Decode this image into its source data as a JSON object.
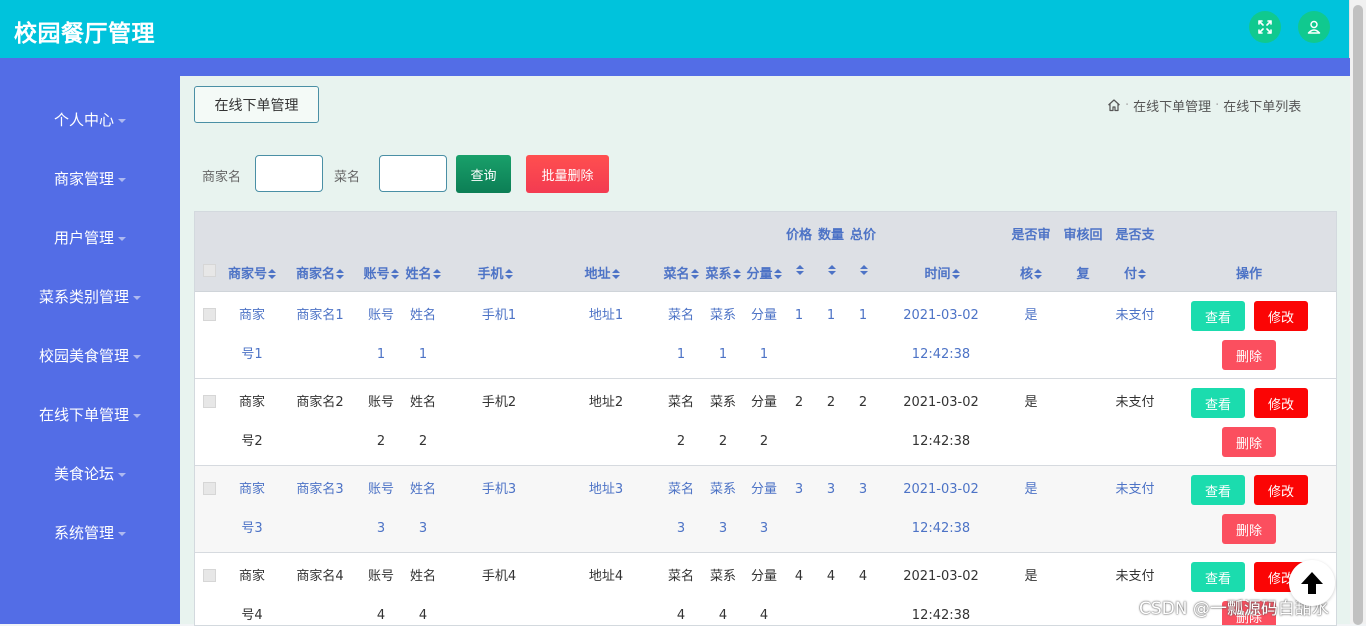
{
  "app": {
    "title": "校园餐厅管理"
  },
  "sidebar": {
    "items": [
      {
        "label": "个人中心"
      },
      {
        "label": "商家管理"
      },
      {
        "label": "用户管理"
      },
      {
        "label": "菜系类别管理"
      },
      {
        "label": "校园美食管理"
      },
      {
        "label": "在线下单管理"
      },
      {
        "label": "美食论坛"
      },
      {
        "label": "系统管理"
      }
    ]
  },
  "page": {
    "tag_label": "在线下单管理",
    "breadcrumb": [
      "在线下单管理",
      "在线下单列表"
    ]
  },
  "search": {
    "merchant_label": "商家名",
    "merchant_value": "",
    "dish_label": "菜名",
    "dish_value": "",
    "query_label": "查询",
    "batch_delete_label": "批量删除"
  },
  "table": {
    "headers": {
      "merchant_no": "商家号",
      "merchant_name": "商家名",
      "account": "账号",
      "name": "姓名",
      "phone": "手机",
      "address": "地址",
      "dish": "菜名",
      "cuisine": "菜系",
      "portion": "分量",
      "price": "价格",
      "quantity": "数量",
      "total": "总价",
      "time": "时间",
      "reviewed_1": "是否审",
      "reviewed_2": "核",
      "reply_1": "审核回",
      "reply_2": "复",
      "paid_1": "是否支",
      "paid_2": "付",
      "actions": "操作"
    },
    "rows": [
      {
        "mno1": "商家",
        "mno2": "号1",
        "mname": "商家名1",
        "acc1": "账号",
        "acc2": "1",
        "nm1": "姓名",
        "nm2": "1",
        "phone": "手机1",
        "addr": "地址1",
        "dish1": "菜名",
        "dish2": "1",
        "cui1": "菜系",
        "cui2": "1",
        "por1": "分量",
        "por2": "1",
        "price": "1",
        "qty": "1",
        "total": "1",
        "time1": "2021-03-02",
        "time2": "12:42:38",
        "reviewed": "是",
        "reply": "",
        "paid": "未支付"
      },
      {
        "mno1": "商家",
        "mno2": "号2",
        "mname": "商家名2",
        "acc1": "账号",
        "acc2": "2",
        "nm1": "姓名",
        "nm2": "2",
        "phone": "手机2",
        "addr": "地址2",
        "dish1": "菜名",
        "dish2": "2",
        "cui1": "菜系",
        "cui2": "2",
        "por1": "分量",
        "por2": "2",
        "price": "2",
        "qty": "2",
        "total": "2",
        "time1": "2021-03-02",
        "time2": "12:42:38",
        "reviewed": "是",
        "reply": "",
        "paid": "未支付"
      },
      {
        "mno1": "商家",
        "mno2": "号3",
        "mname": "商家名3",
        "acc1": "账号",
        "acc2": "3",
        "nm1": "姓名",
        "nm2": "3",
        "phone": "手机3",
        "addr": "地址3",
        "dish1": "菜名",
        "dish2": "3",
        "cui1": "菜系",
        "cui2": "3",
        "por1": "分量",
        "por2": "3",
        "price": "3",
        "qty": "3",
        "total": "3",
        "time1": "2021-03-02",
        "time2": "12:42:38",
        "reviewed": "是",
        "reply": "",
        "paid": "未支付"
      },
      {
        "mno1": "商家",
        "mno2": "号4",
        "mname": "商家名4",
        "acc1": "账号",
        "acc2": "4",
        "nm1": "姓名",
        "nm2": "4",
        "phone": "手机4",
        "addr": "地址4",
        "dish1": "菜名",
        "dish2": "4",
        "cui1": "菜系",
        "cui2": "4",
        "por1": "分量",
        "por2": "4",
        "price": "4",
        "qty": "4",
        "total": "4",
        "time1": "2021-03-02",
        "time2": "12:42:38",
        "reviewed": "是",
        "reply": "",
        "paid": "未支付"
      }
    ],
    "row_actions": {
      "view": "查看",
      "edit": "修改",
      "delete": "删除"
    }
  },
  "watermark": "CSDN @一瓢源码白甜水",
  "colors": {
    "topbar": "#00c3dc",
    "sidebar": "#536de6",
    "main_bg": "#e8f3ef",
    "accent_text": "#4d73c6"
  }
}
